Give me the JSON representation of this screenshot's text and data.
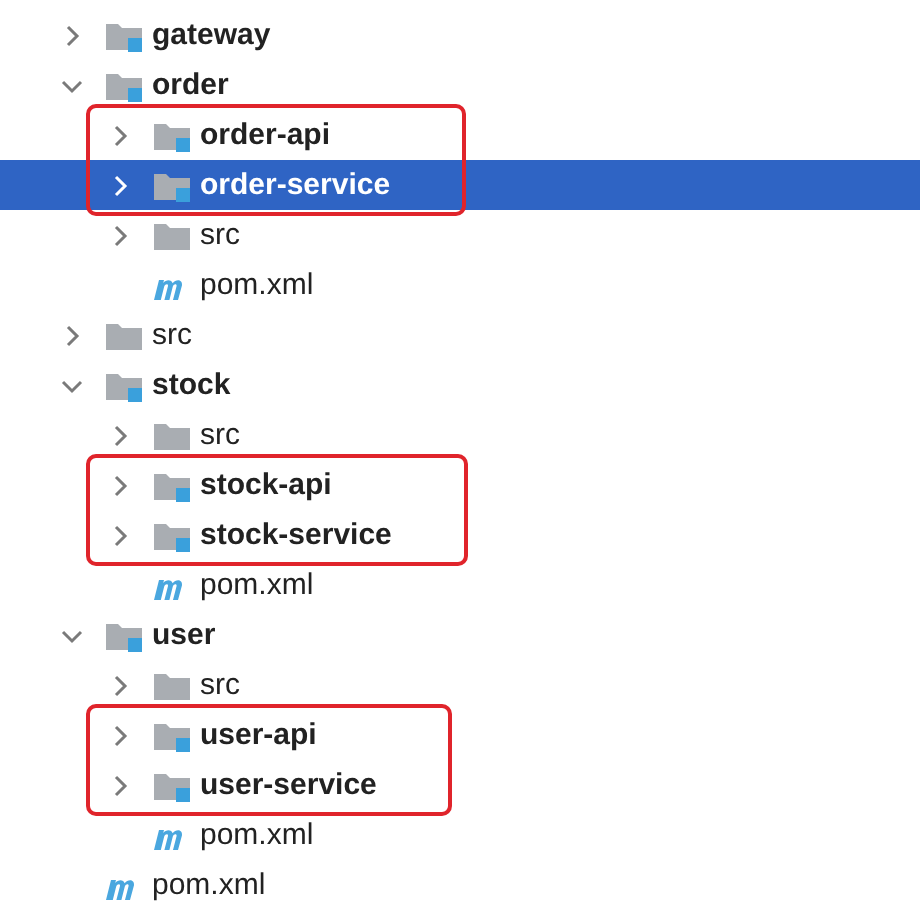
{
  "project_tree": [
    {
      "label": "gateway",
      "kind": "module",
      "expanded": false,
      "selected": false,
      "highlighted": false
    },
    {
      "label": "order",
      "kind": "module",
      "expanded": true,
      "selected": false,
      "highlighted": false,
      "children": [
        {
          "label": "order-api",
          "kind": "module",
          "expanded": false,
          "selected": false,
          "highlighted": true
        },
        {
          "label": "order-service",
          "kind": "module",
          "expanded": false,
          "selected": true,
          "highlighted": true
        },
        {
          "label": "src",
          "kind": "folder",
          "expanded": false,
          "selected": false,
          "highlighted": false
        },
        {
          "label": "pom.xml",
          "kind": "pom",
          "selected": false,
          "highlighted": false
        }
      ]
    },
    {
      "label": "src",
      "kind": "folder",
      "expanded": false,
      "selected": false,
      "highlighted": false
    },
    {
      "label": "stock",
      "kind": "module",
      "expanded": true,
      "selected": false,
      "highlighted": false,
      "children": [
        {
          "label": "src",
          "kind": "folder",
          "expanded": false,
          "selected": false,
          "highlighted": false
        },
        {
          "label": "stock-api",
          "kind": "module",
          "expanded": false,
          "selected": false,
          "highlighted": true
        },
        {
          "label": "stock-service",
          "kind": "module",
          "expanded": false,
          "selected": false,
          "highlighted": true
        },
        {
          "label": "pom.xml",
          "kind": "pom",
          "selected": false,
          "highlighted": false
        }
      ]
    },
    {
      "label": "user",
      "kind": "module",
      "expanded": true,
      "selected": false,
      "highlighted": false,
      "children": [
        {
          "label": "src",
          "kind": "folder",
          "expanded": false,
          "selected": false,
          "highlighted": false
        },
        {
          "label": "user-api",
          "kind": "module",
          "expanded": false,
          "selected": false,
          "highlighted": true
        },
        {
          "label": "user-service",
          "kind": "module",
          "expanded": false,
          "selected": false,
          "highlighted": true
        },
        {
          "label": "pom.xml",
          "kind": "pom",
          "selected": false,
          "highlighted": false
        }
      ]
    },
    {
      "label": "pom.xml",
      "kind": "pom",
      "selected": false,
      "highlighted": false
    }
  ]
}
